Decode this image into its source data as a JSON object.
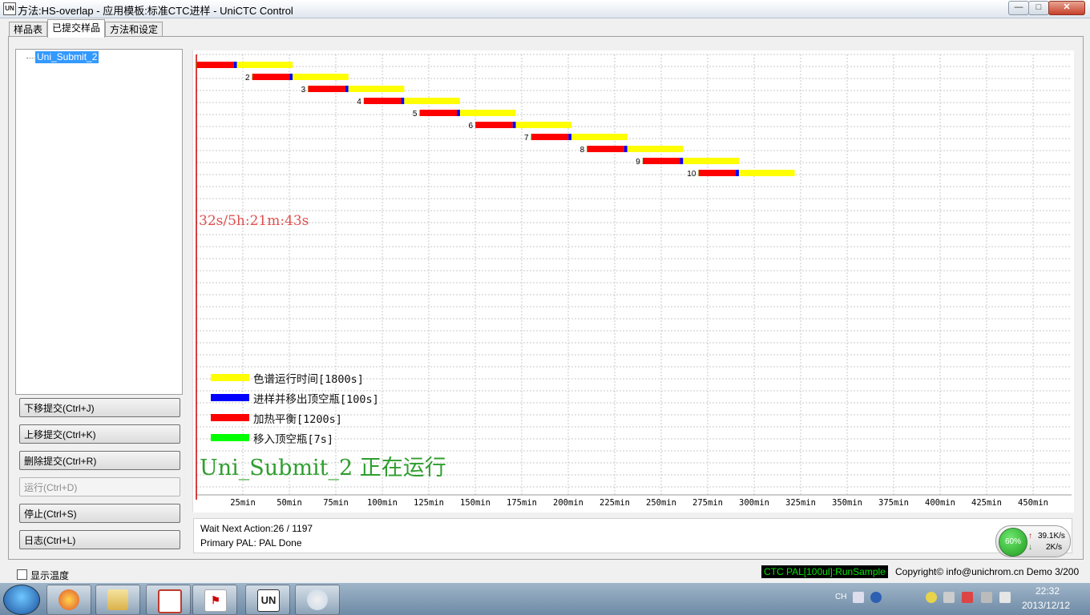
{
  "window": {
    "title": "方法:HS-overlap - 应用模板:标准CTC进样 - UniCTC Control",
    "app_icon": "UN",
    "min_glyph": "—",
    "max_glyph": "□",
    "close_glyph": "✕"
  },
  "tabs": [
    {
      "label": "样品表"
    },
    {
      "label": "已提交样品"
    },
    {
      "label": "方法和设定"
    }
  ],
  "tree": {
    "item": "Uni_Submit_2"
  },
  "buttons": [
    {
      "label": "下移提交(Ctrl+J)",
      "enabled": true
    },
    {
      "label": "上移提交(Ctrl+K)",
      "enabled": true
    },
    {
      "label": "删除提交(Ctrl+R)",
      "enabled": true
    },
    {
      "label": "运行(Ctrl+D)",
      "enabled": false
    },
    {
      "label": "停止(Ctrl+S)",
      "enabled": true
    },
    {
      "label": "日志(Ctrl+L)",
      "enabled": true
    }
  ],
  "chart_data": {
    "type": "gantt",
    "x_unit": "min",
    "x_range": [
      0,
      475
    ],
    "x_ticks": [
      "25min",
      "50min",
      "75min",
      "100min",
      "125min",
      "150min",
      "175min",
      "200min",
      "225min",
      "250min",
      "275min",
      "300min",
      "325min",
      "350min",
      "375min",
      "400min",
      "425min",
      "450min"
    ],
    "rows_total": 36,
    "colors": {
      "run": "#ffff00",
      "inject": "#0000ff",
      "heat": "#ff0000",
      "move": "#00ff00",
      "cursor": "#cc0000"
    },
    "samples": [
      {
        "label": "",
        "start": 0
      },
      {
        "label": "2",
        "start": 30
      },
      {
        "label": "3",
        "start": 60
      },
      {
        "label": "4",
        "start": 90
      },
      {
        "label": "5",
        "start": 120
      },
      {
        "label": "6",
        "start": 150
      },
      {
        "label": "7",
        "start": 180
      },
      {
        "label": "8",
        "start": 210
      },
      {
        "label": "9",
        "start": 240
      },
      {
        "label": "10",
        "start": 270
      }
    ],
    "phases_min": {
      "move": 0.12,
      "heat": 20,
      "inject": 1.67,
      "run": 30
    },
    "legend": [
      {
        "label": "色谱运行时间[1800s]",
        "color": "#ffff00"
      },
      {
        "label": "进样并移出顶空瓶[100s]",
        "color": "#0000ff"
      },
      {
        "label": "加热平衡[1200s]",
        "color": "#ff0000"
      },
      {
        "label": "移入顶空瓶[7s]",
        "color": "#00ff00"
      }
    ]
  },
  "chart_overlay": {
    "elapsed": "32s/5h:21m:43s",
    "running": "Uni_Submit_2 正在运行"
  },
  "status": {
    "line1": "Wait Next Action:26 / 1197",
    "line2": "Primary PAL: PAL Done"
  },
  "gadget": {
    "percent": "60%",
    "up": "39.1K/s",
    "down": "2K/s",
    "up_arrow": "↑",
    "down_arrow": "↓"
  },
  "footer": {
    "temp_label": "显示温度",
    "pal_status": "CTC PAL[100ul]:RunSample",
    "copyright": "Copyright© info@unichrom.cn Demo 3/200"
  },
  "taskbar": {
    "lang": "CH",
    "time": "22:32",
    "date": "2013/12/12",
    "apps": [
      {
        "icon": "paint-palette-icon"
      },
      {
        "icon": "file-explorer-icon"
      },
      {
        "icon": "presentation-icon"
      },
      {
        "icon": "pdf-reader-icon"
      },
      {
        "icon": "unictc-app-icon",
        "text": "UN"
      },
      {
        "icon": "paint-icon"
      }
    ]
  }
}
